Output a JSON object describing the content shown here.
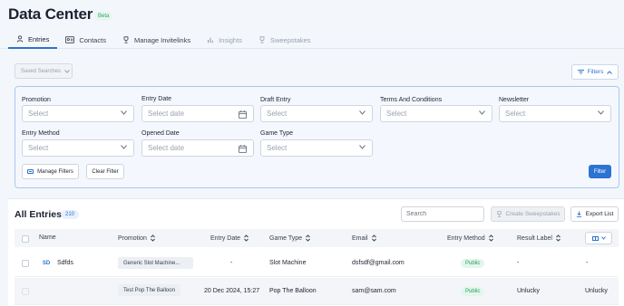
{
  "header": {
    "title": "Data Center",
    "badge": "Beta"
  },
  "tabs": [
    {
      "label": "Entries",
      "icon": "user-icon",
      "active": true
    },
    {
      "label": "Contacts",
      "icon": "contact-card-icon"
    },
    {
      "label": "Manage Invitelinks",
      "icon": "trophy-icon"
    },
    {
      "label": "Insights",
      "icon": "bar-chart-icon",
      "disabled": true
    },
    {
      "label": "Sweepstakes",
      "icon": "trophy-icon",
      "disabled": true
    }
  ],
  "toolbar": {
    "saved_searches": "Saved Searches",
    "filters": "Filters"
  },
  "filters": {
    "promotion": {
      "label": "Promotion",
      "placeholder": "Select"
    },
    "entry_date": {
      "label": "Entry Date",
      "placeholder": "Select date"
    },
    "draft_entry": {
      "label": "Draft Entry",
      "placeholder": "Select"
    },
    "terms": {
      "label": "Terms And Conditions",
      "placeholder": "Select"
    },
    "newsletter": {
      "label": "Newsletter",
      "placeholder": "Select"
    },
    "entry_method": {
      "label": "Entry Method",
      "placeholder": "Select"
    },
    "opened_date": {
      "label": "Opened Date",
      "placeholder": "Select date"
    },
    "game_type": {
      "label": "Game Type",
      "placeholder": "Select"
    },
    "manage_filters": "Manage Filters",
    "clear_filter": "Clear Filter",
    "filter": "Filter"
  },
  "entries": {
    "title": "All Entries",
    "count": "210",
    "search_placeholder": "Search",
    "create_sweepstakes": "Create Sweepstakes",
    "export_list": "Export List"
  },
  "table": {
    "columns": [
      "Name",
      "Promotion",
      "Entry Date",
      "Game Type",
      "Email",
      "Entry Method",
      "Result Label"
    ],
    "rows": [
      {
        "initials": "SD",
        "name": "Sdfds",
        "promotion": "Generic Slot Machine...",
        "entry_date": "-",
        "game_type": "Slot Machine",
        "email": "dsfsdf@gmail.com",
        "entry_method": "Public",
        "result_label": "-",
        "last": "-"
      },
      {
        "initials": "",
        "name": "",
        "promotion": "Test Pop The Balloon",
        "entry_date": "20 Dec 2024, 15:27",
        "game_type": "Pop The Balloon",
        "email": "sam@sam.com",
        "entry_method": "Public",
        "result_label": "Unlucky",
        "last": "Unlucky"
      }
    ]
  },
  "colors": {
    "accent": "#2c73d2",
    "success": "#23a05a",
    "page_bg": "#f3f6fb",
    "panel_border": "#a9c9ef"
  }
}
